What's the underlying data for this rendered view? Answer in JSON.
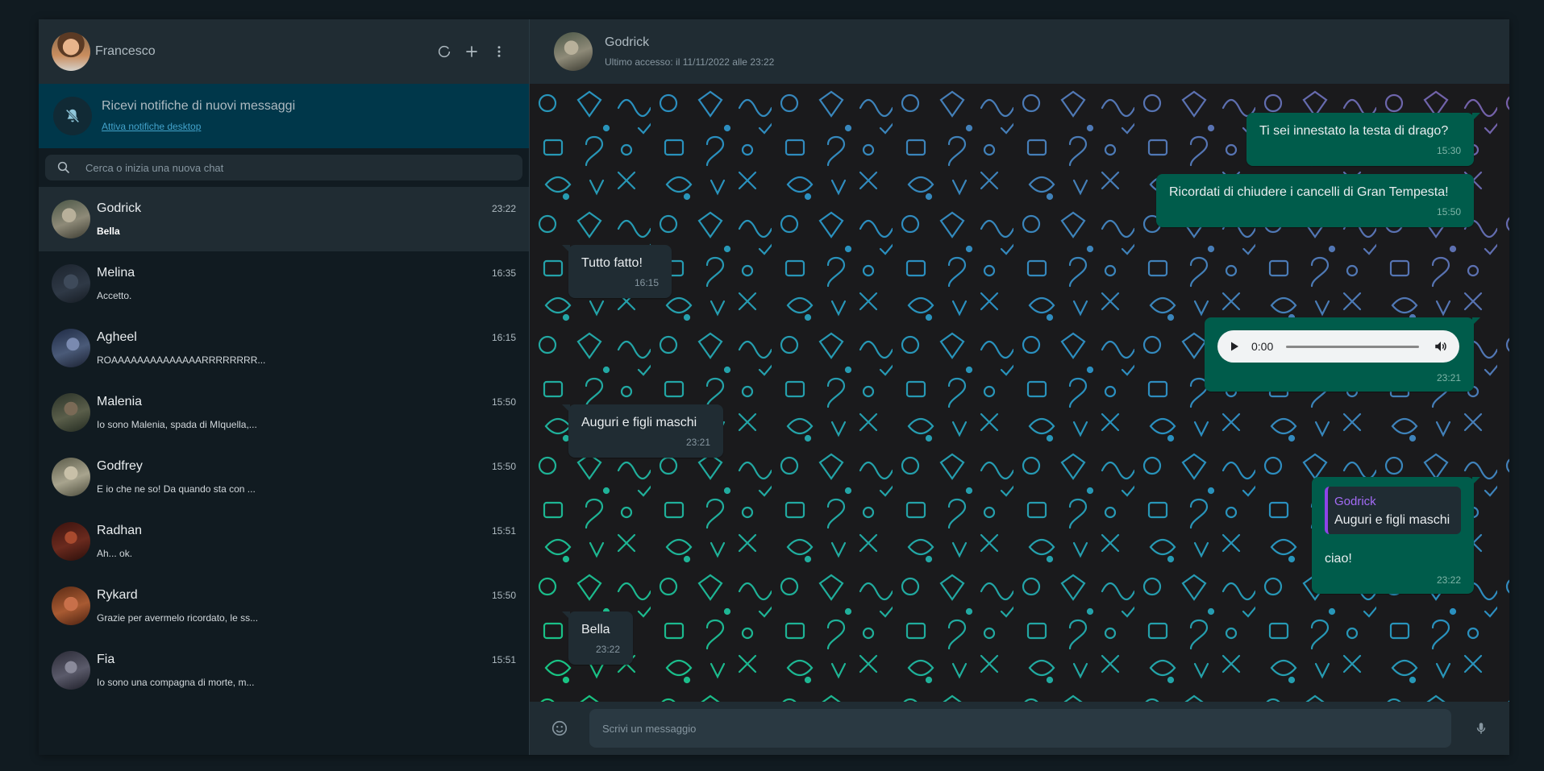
{
  "me": {
    "name": "Francesco"
  },
  "notification": {
    "title": "Ricevi notifiche di nuovi messaggi",
    "link": "Attiva notifiche desktop"
  },
  "search": {
    "placeholder": "Cerca o inizia una nuova chat"
  },
  "chats": [
    {
      "name": "Godrick",
      "time": "23:22",
      "last": "Bella",
      "color": "#6e7a6a"
    },
    {
      "name": "Melina",
      "time": "16:35",
      "last": "Accetto.",
      "color": "#2f3946"
    },
    {
      "name": "Agheel",
      "time": "16:15",
      "last": "ROAAAAAAAAAAAAAARRRRRRRR...",
      "color": "#4a5a78"
    },
    {
      "name": "Malenia",
      "time": "15:50",
      "last": "Io sono Malenia, spada di MIquella,...",
      "color": "#5a5e4a"
    },
    {
      "name": "Godfrey",
      "time": "15:50",
      "last": "E io che ne so! Da quando sta con ...",
      "color": "#8a8a74"
    },
    {
      "name": "Radhan",
      "time": "15:51",
      "last": "Ah... ok.",
      "color": "#6a2a1e"
    },
    {
      "name": "Rykard",
      "time": "15:50",
      "last": "Grazie per avermelo ricordato, le ss...",
      "color": "#8a4a2a"
    },
    {
      "name": "Fia",
      "time": "15:51",
      "last": "Io sono una compagna di morte, m...",
      "color": "#4a4a5a"
    }
  ],
  "conversation": {
    "name": "Godrick",
    "status": "Ultimo accesso: il 11/11/2022 alle 23:22",
    "messages": [
      {
        "text": "Ti sei innestato la testa di drago?",
        "time": "15:30"
      },
      {
        "text": "Ricordati di chiudere i cancelli di Gran Tempesta!",
        "time": "15:50"
      },
      {
        "text": "Tutto fatto!",
        "time": "16:15"
      },
      {
        "audio_time": "0:00",
        "time": "23:21"
      },
      {
        "text": "Auguri e figli maschi",
        "time": "23:21"
      },
      {
        "quote_name": "Godrick",
        "quote_text": "Auguri e figli maschi",
        "text": "ciao!",
        "time": "23:22"
      },
      {
        "text": "Bella",
        "time": "23:22"
      }
    ]
  },
  "composer": {
    "placeholder": "Scrivi un messaggio"
  }
}
